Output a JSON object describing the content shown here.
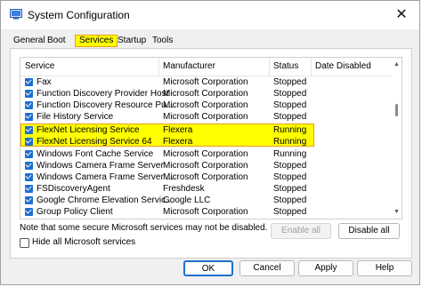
{
  "window": {
    "title": "System Configuration",
    "close_glyph": "✕"
  },
  "tabs": [
    "General",
    "Boot",
    "Services",
    "Startup",
    "Tools"
  ],
  "columns": {
    "service": "Service",
    "manufacturer": "Manufacturer",
    "status": "Status",
    "date_disabled": "Date Disabled"
  },
  "rows": [
    {
      "service": "Fax",
      "manufacturer": "Microsoft Corporation",
      "status": "Stopped",
      "date_disabled": ""
    },
    {
      "service": "Function Discovery Provider Host",
      "manufacturer": "Microsoft Corporation",
      "status": "Stopped",
      "date_disabled": ""
    },
    {
      "service": "Function Discovery Resource Pu...",
      "manufacturer": "Microsoft Corporation",
      "status": "Stopped",
      "date_disabled": ""
    },
    {
      "service": "File History Service",
      "manufacturer": "Microsoft Corporation",
      "status": "Stopped",
      "date_disabled": ""
    },
    {
      "service": "FlexNet Licensing Service",
      "manufacturer": "Flexera",
      "status": "Running",
      "date_disabled": ""
    },
    {
      "service": "FlexNet Licensing Service 64",
      "manufacturer": "Flexera",
      "status": "Running",
      "date_disabled": ""
    },
    {
      "service": "Windows Font Cache Service",
      "manufacturer": "Microsoft Corporation",
      "status": "Running",
      "date_disabled": ""
    },
    {
      "service": "Windows Camera Frame Server",
      "manufacturer": "Microsoft Corporation",
      "status": "Stopped",
      "date_disabled": ""
    },
    {
      "service": "Windows Camera Frame Server ...",
      "manufacturer": "Microsoft Corporation",
      "status": "Stopped",
      "date_disabled": ""
    },
    {
      "service": "FSDiscoveryAgent",
      "manufacturer": "Freshdesk",
      "status": "Stopped",
      "date_disabled": ""
    },
    {
      "service": "Google Chrome Elevation Servic...",
      "manufacturer": "Google LLC",
      "status": "Stopped",
      "date_disabled": ""
    },
    {
      "service": "Group Policy Client",
      "manufacturer": "Microsoft Corporation",
      "status": "Stopped",
      "date_disabled": ""
    }
  ],
  "note": "Note that some secure Microsoft services may not be disabled.",
  "enable_all": "Enable all",
  "disable_all": "Disable all",
  "hide_ms": "Hide all Microsoft services",
  "buttons": {
    "ok": "OK",
    "cancel": "Cancel",
    "apply": "Apply",
    "help": "Help"
  },
  "colors": {
    "highlight": "#ffff00",
    "highlight_border": "#e8a000",
    "checkbox": "#1f6fd0"
  },
  "icons": {
    "app": "system-config-icon",
    "checkbox": "checkmark-icon"
  }
}
